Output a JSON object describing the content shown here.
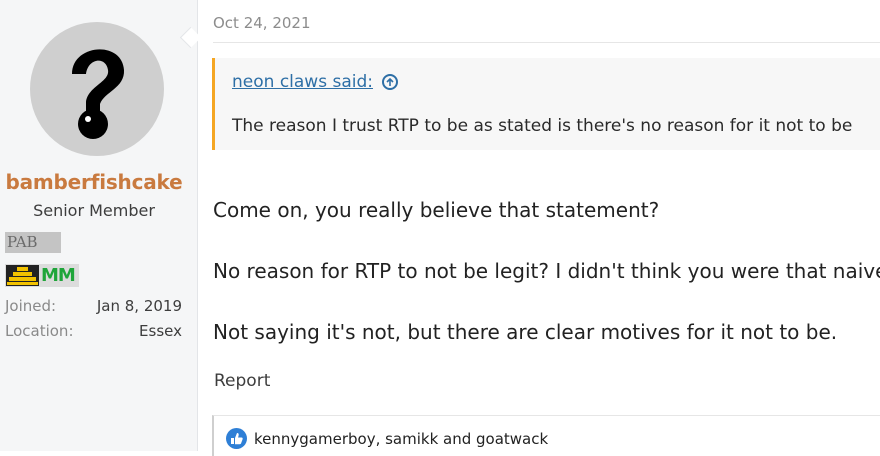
{
  "post": {
    "date": "Oct 24, 2021",
    "author": {
      "username": "bamberfishcake",
      "title": "Senior Member",
      "badge1": "PAB",
      "badge2": "MM",
      "joined_label": "Joined:",
      "joined_value": "Jan 8, 2019",
      "location_label": "Location:",
      "location_value": "Essex"
    },
    "quote": {
      "author": "neon claws said:",
      "text": "The reason I trust RTP to be as stated is there's no reason for it not to be"
    },
    "body": [
      "Come on, you really believe that statement?",
      "No reason for RTP to not be legit? I didn't think you were that naive.",
      "Not saying it's not, but there are clear motives for it not to be."
    ],
    "report_label": "Report",
    "reactions_text": "kennygamerboy, samikk and goatwack"
  },
  "colors": {
    "username": "#c97a3f",
    "quote_accent": "#f5a623",
    "link": "#2e6fa6",
    "like": "#2e7fd6"
  },
  "icons": {
    "avatar": "question-mark-avatar",
    "quote_jump": "arrow-up-circle-icon",
    "reaction": "like-thumb-icon",
    "badge": "beehive-badge-icon"
  }
}
